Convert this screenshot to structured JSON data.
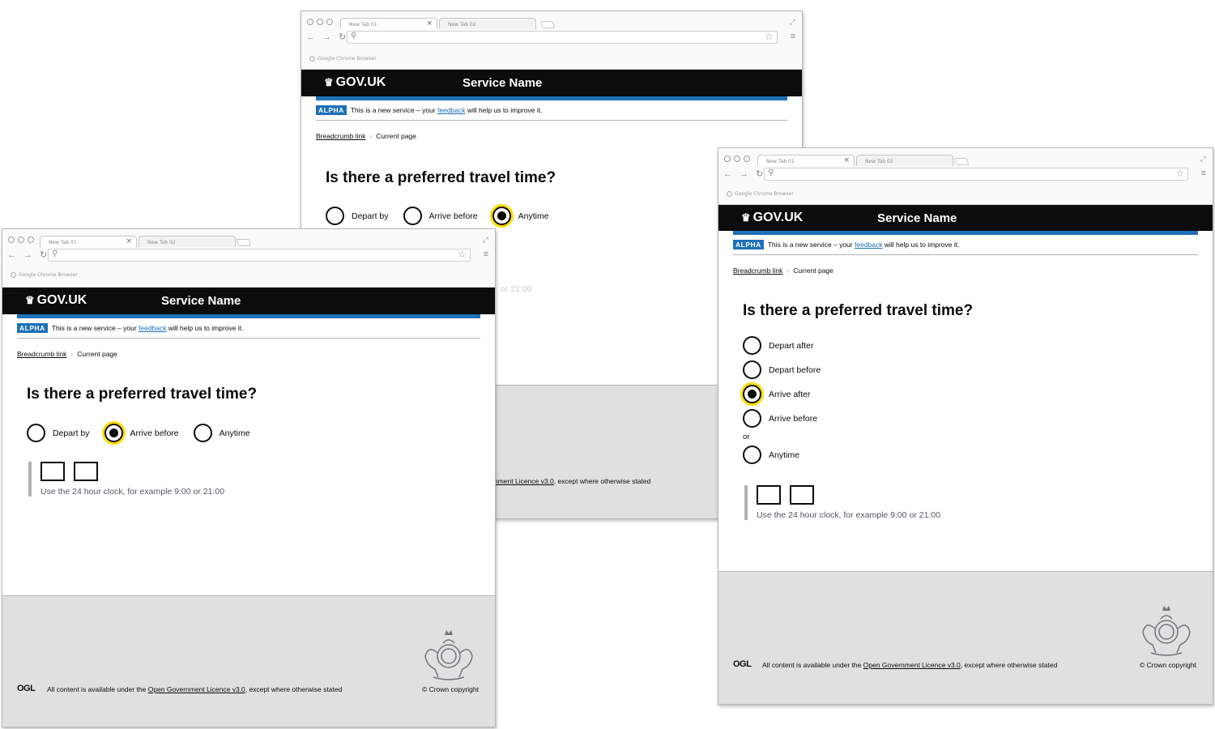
{
  "browser": {
    "tab1": "New Tab 01",
    "tab2": "New Tab 02",
    "bookmark": "Google Chrome Browser"
  },
  "header": {
    "logo": "GOV.UK",
    "service_name": "Service Name"
  },
  "banner": {
    "tag": "ALPHA",
    "text_before": "This is a new service – your ",
    "link": "feedback",
    "text_after": " will help us to improve it."
  },
  "breadcrumb": {
    "link": "Breadcrumb link",
    "current": "Current page"
  },
  "question": "Is there a preferred travel time?",
  "back_window": {
    "options": [
      "Depart by",
      "Arrive before",
      "Anytime"
    ],
    "selected": "Anytime",
    "hint_fragment": "or 21:00",
    "licence_fragment": "nment Licence v3.0",
    "licence_after": ", except where otherwise stated"
  },
  "left_window": {
    "options": [
      "Depart by",
      "Arrive before",
      "Anytime"
    ],
    "selected": "Arrive before"
  },
  "right_window": {
    "options": [
      "Depart after",
      "Depart before",
      "Arrive after",
      "Arrive before"
    ],
    "divider": "or",
    "last_option": "Anytime",
    "selected": "Arrive after"
  },
  "time_hint": "Use the 24 hour clock, for example 9:00 or 21:00",
  "footer": {
    "ogl": "OGL",
    "licence_before": "All content is available under the ",
    "licence_link": "Open Government Licence v3.0",
    "licence_after": ", except where otherwise stated",
    "copyright": "© Crown copyright"
  },
  "colors": {
    "header_bg": "#0b0c0c",
    "brand_blue": "#1d70b8",
    "focus_yellow": "#ffdd00",
    "footer_bg": "#dfe0e0"
  }
}
